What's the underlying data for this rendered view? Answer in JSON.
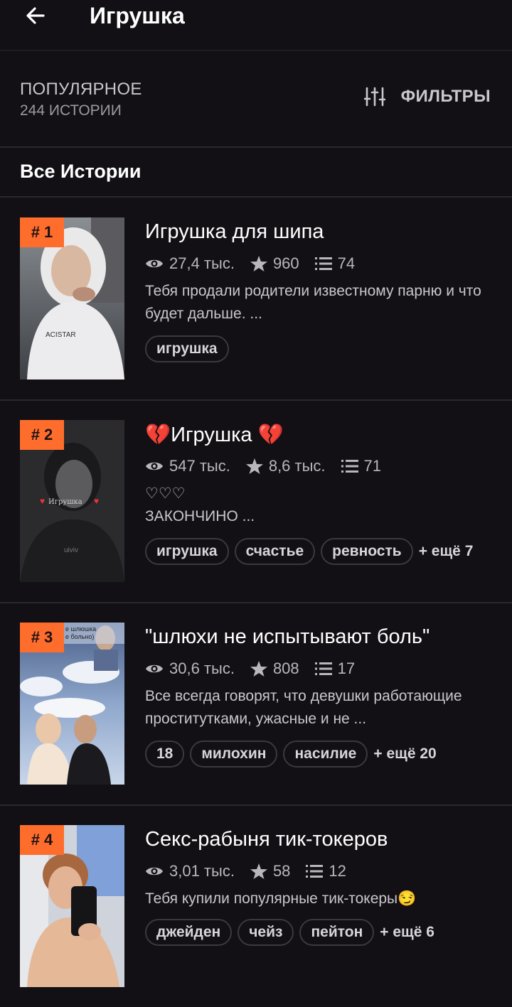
{
  "header": {
    "title": "Игрушка"
  },
  "popular": {
    "title": "ПОПУЛЯРНОЕ",
    "count": "244 ИСТОРИИ",
    "filters_label": "ФИЛЬТРЫ"
  },
  "all_stories_title": "Все Истории",
  "stories": [
    {
      "rank": "# 1",
      "title": "Игрушка для шипа",
      "views": "27,4 тыс.",
      "votes": "960",
      "parts": "74",
      "description": "Тебя продали родители известному парню и что будет дальше. ...",
      "tags": [
        "игрушка"
      ],
      "more": ""
    },
    {
      "rank": "# 2",
      "title": "💔Игрушка 💔",
      "views": "547 тыс.",
      "votes": "8,6 тыс.",
      "parts": "71",
      "description": "♡♡♡\nЗАКОНЧИНО ...",
      "tags": [
        "игрушка",
        "счастье",
        "ревность"
      ],
      "more": "+ ещё 7"
    },
    {
      "rank": "# 3",
      "title": "\"шлюхи не испытывают боль\"",
      "views": "30,6 тыс.",
      "votes": "808",
      "parts": "17",
      "description": "Все всегда говорят, что девушки работающие проститутками, ужасные и не ...",
      "tags": [
        "18",
        "милохин",
        "насилие"
      ],
      "more": "+ ещё 20"
    },
    {
      "rank": "# 4",
      "title": "Секс-рабыня тик-токеров",
      "views": "3,01 тыс.",
      "votes": "58",
      "parts": "12",
      "description": "Тебя купили популярные тик-токеры😏",
      "tags": [
        "джейден",
        "чейз",
        "пейтон"
      ],
      "more": "+ ещё 6"
    }
  ],
  "cover_text": {
    "cover2_caption": "Игрушка",
    "cover3_caption": "е шлюшка\nе больно)"
  },
  "colors": {
    "background": "#121014",
    "accent": "#ff6d2d",
    "divider": "#2a282d",
    "muted_text": "#b9b7bc"
  },
  "icons": {
    "back": "arrow-left-icon",
    "filters": "sliders-icon",
    "views": "eye-icon",
    "votes": "star-icon",
    "parts": "list-icon"
  }
}
